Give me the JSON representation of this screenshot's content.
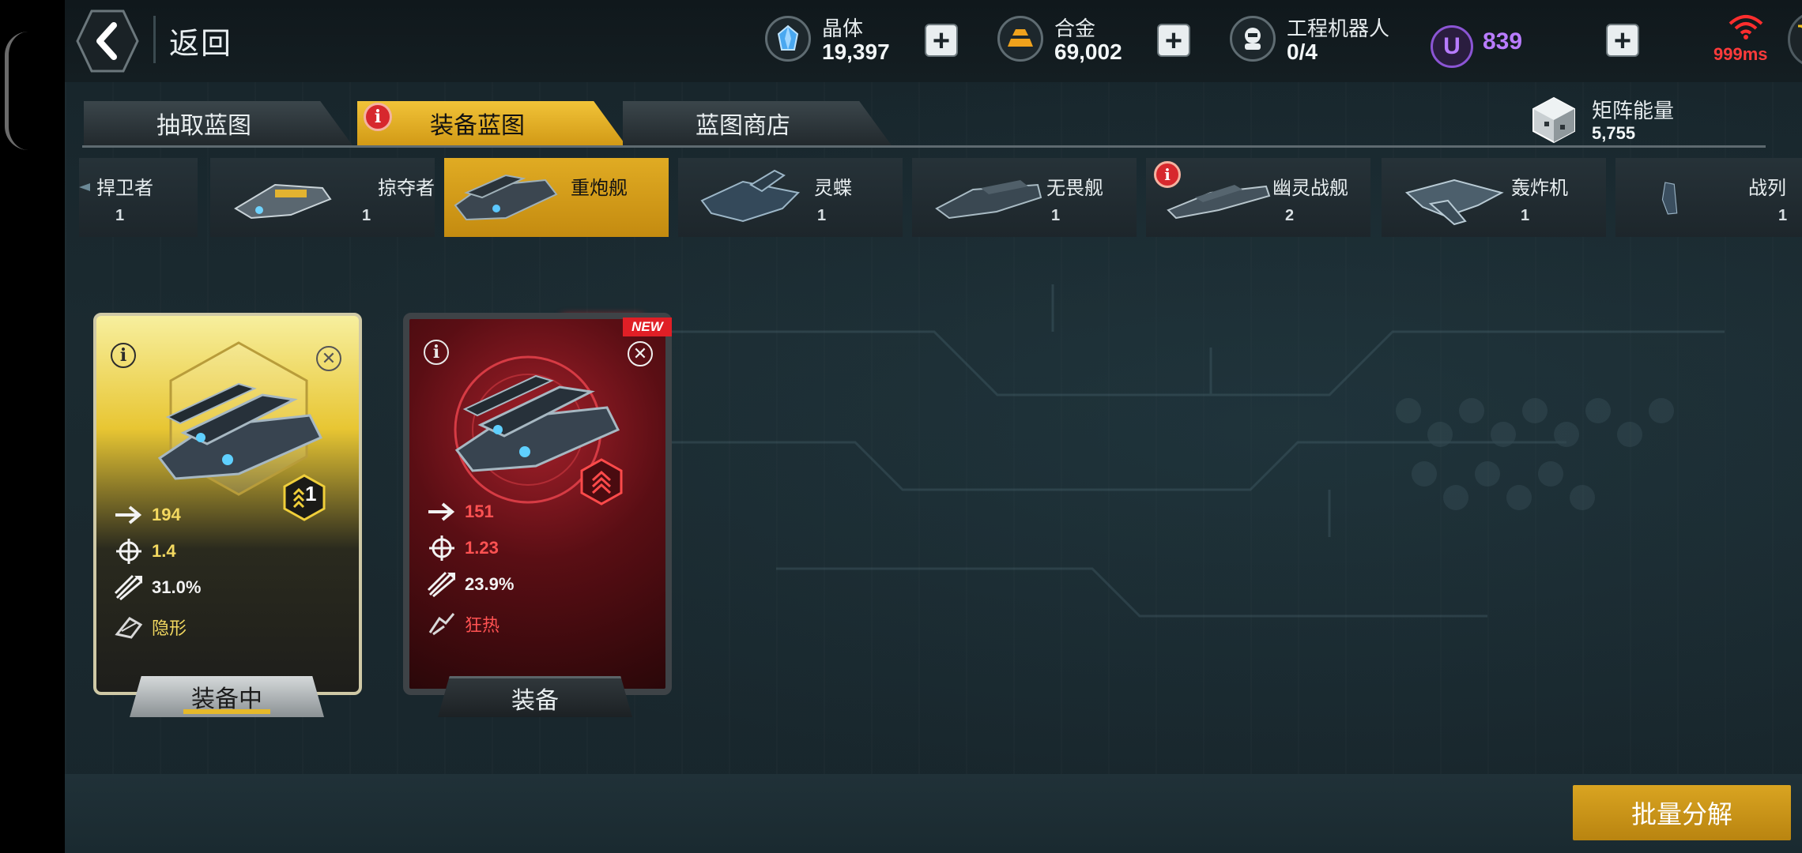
{
  "top_bar": {
    "back_label": "返回",
    "resources": [
      {
        "label": "晶体",
        "value": "19,397",
        "icon": "crystal-icon"
      },
      {
        "label": "合金",
        "value": "69,002",
        "icon": "alloy-icon"
      },
      {
        "label": "工程机器人",
        "value": "0/4",
        "icon": "robot-icon"
      }
    ],
    "u_currency": {
      "icon_letter": "U",
      "value": "839"
    },
    "ping": "999ms",
    "cart_badge": "!"
  },
  "tabs": [
    {
      "label": "抽取蓝图",
      "active": false
    },
    {
      "label": "装备蓝图",
      "active": true,
      "alert": "i"
    },
    {
      "label": "蓝图商店",
      "active": false
    }
  ],
  "matrix_energy": {
    "label": "矩阵能量",
    "value": "5,755"
  },
  "categories": [
    {
      "name": "捍卫者",
      "count": "1"
    },
    {
      "name": "掠夺者",
      "count": "1"
    },
    {
      "name": "重炮舰",
      "count": "",
      "selected": true
    },
    {
      "name": "灵蝶",
      "count": "1"
    },
    {
      "name": "无畏舰",
      "count": "1"
    },
    {
      "name": "幽灵战舰",
      "count": "2",
      "alert": "i"
    },
    {
      "name": "轰炸机",
      "count": "1"
    },
    {
      "name": "战列",
      "count": "1"
    }
  ],
  "cards": [
    {
      "speed": "194",
      "accuracy": "1.4",
      "percent": "31.0%",
      "trait": "隐形",
      "rank": "1",
      "button": "装备中",
      "info": "i"
    },
    {
      "new_badge": "NEW",
      "speed": "151",
      "accuracy": "1.23",
      "percent": "23.9%",
      "trait": "狂热",
      "button": "装备",
      "info": "i"
    }
  ],
  "bulk_button": "批量分解",
  "colors": {
    "accent_gold": "#d9a421",
    "alert_red": "#d7282d",
    "u_purple": "#b97cff"
  }
}
